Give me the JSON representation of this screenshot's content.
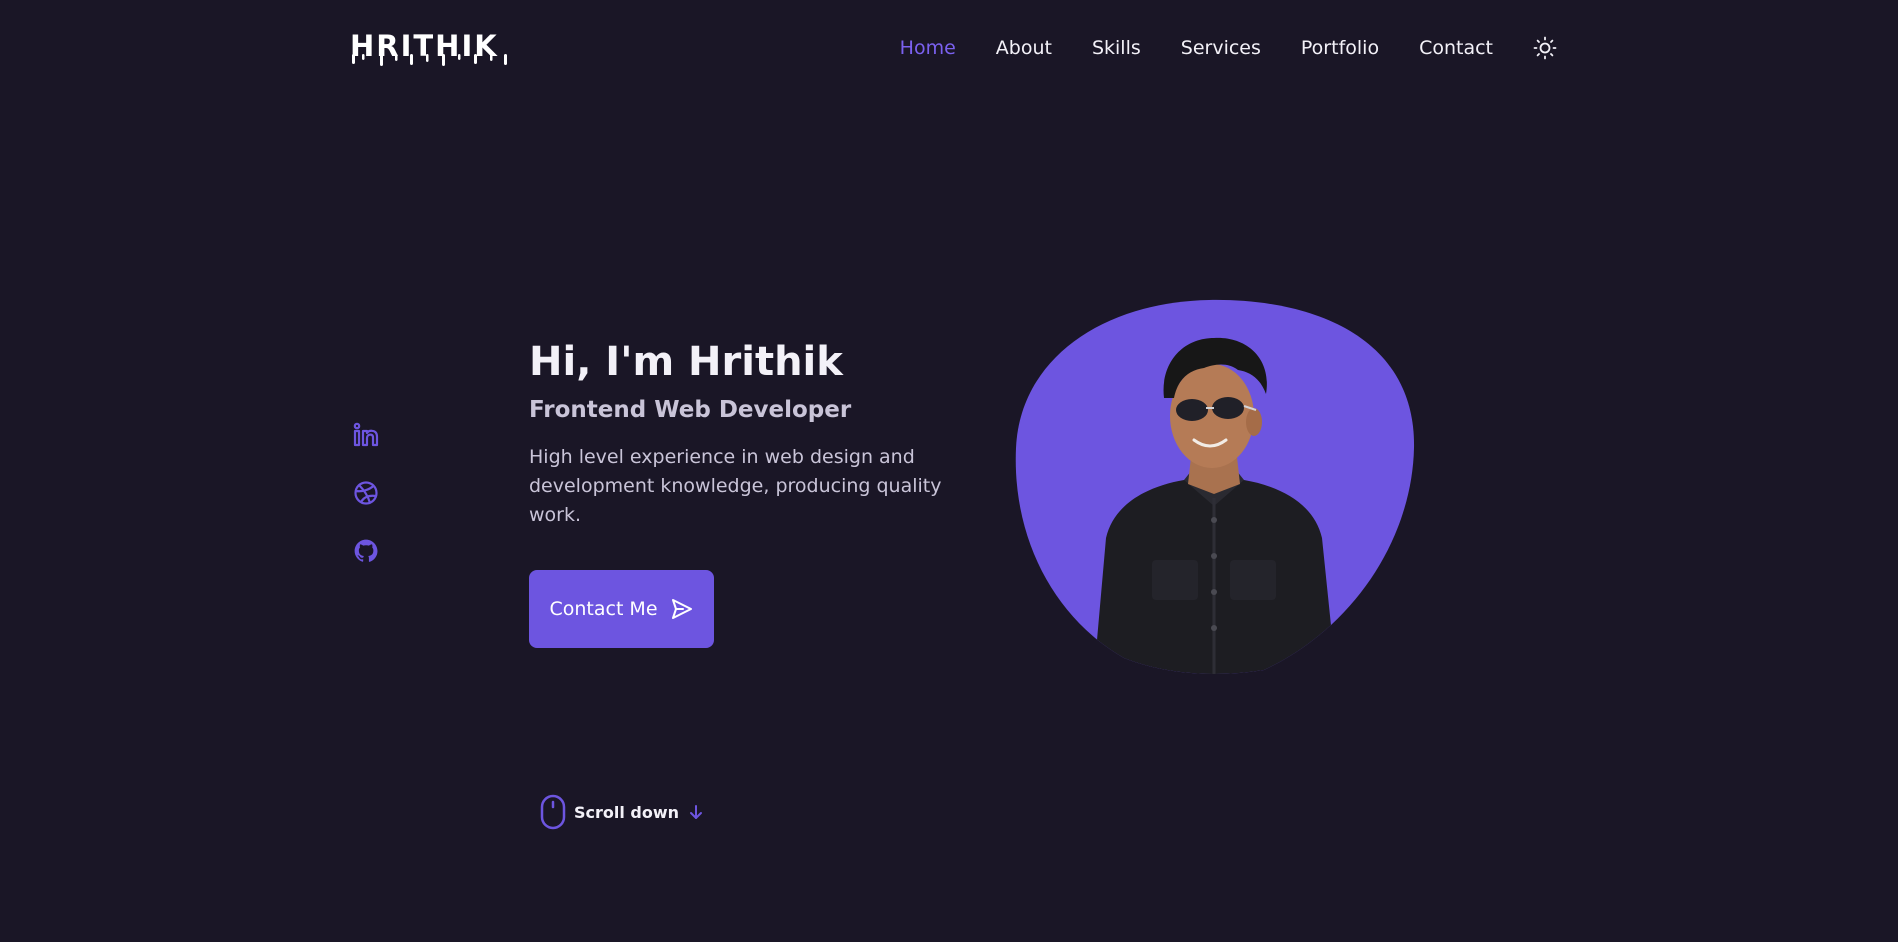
{
  "header": {
    "logo": "HRITHIK",
    "nav": [
      {
        "label": "Home",
        "active": true
      },
      {
        "label": "About",
        "active": false
      },
      {
        "label": "Skills",
        "active": false
      },
      {
        "label": "Services",
        "active": false
      },
      {
        "label": "Portfolio",
        "active": false
      },
      {
        "label": "Contact",
        "active": false
      }
    ],
    "theme_toggle_icon": "sun-icon"
  },
  "social": [
    {
      "icon": "linkedin-icon"
    },
    {
      "icon": "dribbble-icon"
    },
    {
      "icon": "github-icon"
    }
  ],
  "hero": {
    "title": "Hi, I'm Hrithik",
    "subtitle": "Frontend Web Developer",
    "description": "High level experience in web design and development knowledge, producing quality work.",
    "button_label": "Contact Me",
    "button_icon": "send-icon"
  },
  "scroll": {
    "label": "Scroll down",
    "icon": "mouse-icon",
    "arrow_icon": "arrow-down-icon"
  },
  "colors": {
    "background": "#1a1626",
    "accent": "#6d55e0",
    "accent_text": "#7b61f0",
    "text": "#f3f1f8",
    "muted_text": "#c9c4d8"
  }
}
